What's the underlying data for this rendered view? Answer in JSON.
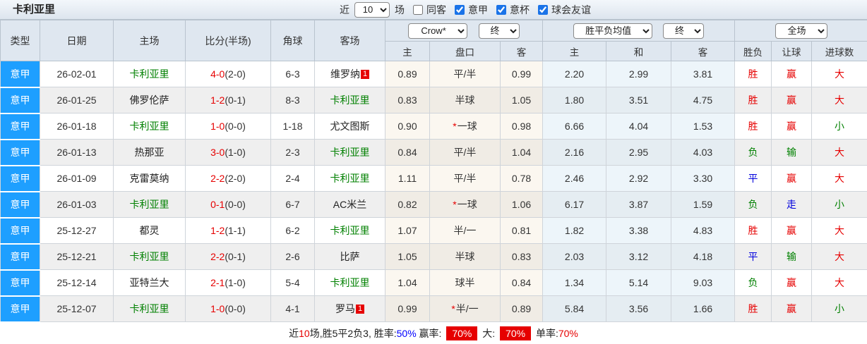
{
  "topbar": {
    "title": "卡利亚里",
    "near_label": "近",
    "near_value": "10",
    "games_label": "场",
    "filters": [
      {
        "label": "同客",
        "checked": false
      },
      {
        "label": "意甲",
        "checked": true
      },
      {
        "label": "意杯",
        "checked": true
      },
      {
        "label": "球会友谊",
        "checked": true
      }
    ]
  },
  "colors": {
    "league_cell_blue": "#1e9fff",
    "self_team_green": "#008000",
    "win_red": "#e60000",
    "draw_blue": "#0000dd",
    "rate_blue": "#0000ff"
  },
  "table": {
    "left_headers": [
      "类型",
      "日期",
      "主场",
      "比分(半场)",
      "角球",
      "客场"
    ],
    "odds_group": {
      "provider_select": "Crow*",
      "time_select": "终",
      "subcols": [
        "主",
        "盘口",
        "客"
      ]
    },
    "avg_group": {
      "name_select": "胜平负均值",
      "time_select": "终",
      "subcols": [
        "主",
        "和",
        "客"
      ]
    },
    "result_group": {
      "scope_select": "全场",
      "subcols": [
        "胜负",
        "让球",
        "进球数"
      ]
    },
    "rows": [
      {
        "league": "意甲",
        "date": "26-02-01",
        "home": "卡利亚里",
        "home_is_self": true,
        "home_badge": null,
        "score_ft": "4-0",
        "score_ht": "(2-0)",
        "corners": "6-3",
        "away": "维罗纳",
        "away_is_self": false,
        "away_badge": "1",
        "odds_home": "0.89",
        "handicap_star": false,
        "handicap": "平/半",
        "odds_away": "0.99",
        "avg_home": "2.20",
        "avg_draw": "2.99",
        "avg_away": "3.81",
        "result": {
          "t": "胜",
          "c": "red"
        },
        "handicap_result": {
          "t": "赢",
          "c": "red"
        },
        "goals": {
          "t": "大",
          "c": "red"
        }
      },
      {
        "league": "意甲",
        "date": "26-01-25",
        "home": "佛罗伦萨",
        "home_is_self": false,
        "home_badge": null,
        "score_ft": "1-2",
        "score_ht": "(0-1)",
        "corners": "8-3",
        "away": "卡利亚里",
        "away_is_self": true,
        "away_badge": null,
        "odds_home": "0.83",
        "handicap_star": false,
        "handicap": "半球",
        "odds_away": "1.05",
        "avg_home": "1.80",
        "avg_draw": "3.51",
        "avg_away": "4.75",
        "result": {
          "t": "胜",
          "c": "red"
        },
        "handicap_result": {
          "t": "赢",
          "c": "red"
        },
        "goals": {
          "t": "大",
          "c": "red"
        }
      },
      {
        "league": "意甲",
        "date": "26-01-18",
        "home": "卡利亚里",
        "home_is_self": true,
        "home_badge": null,
        "score_ft": "1-0",
        "score_ht": "(0-0)",
        "corners": "1-18",
        "away": "尤文图斯",
        "away_is_self": false,
        "away_badge": null,
        "odds_home": "0.90",
        "handicap_star": true,
        "handicap": "一球",
        "odds_away": "0.98",
        "avg_home": "6.66",
        "avg_draw": "4.04",
        "avg_away": "1.53",
        "result": {
          "t": "胜",
          "c": "red"
        },
        "handicap_result": {
          "t": "赢",
          "c": "red"
        },
        "goals": {
          "t": "小",
          "c": "green"
        }
      },
      {
        "league": "意甲",
        "date": "26-01-13",
        "home": "热那亚",
        "home_is_self": false,
        "home_badge": null,
        "score_ft": "3-0",
        "score_ht": "(1-0)",
        "corners": "2-3",
        "away": "卡利亚里",
        "away_is_self": true,
        "away_badge": null,
        "odds_home": "0.84",
        "handicap_star": false,
        "handicap": "平/半",
        "odds_away": "1.04",
        "avg_home": "2.16",
        "avg_draw": "2.95",
        "avg_away": "4.03",
        "result": {
          "t": "负",
          "c": "green"
        },
        "handicap_result": {
          "t": "输",
          "c": "green"
        },
        "goals": {
          "t": "大",
          "c": "red"
        }
      },
      {
        "league": "意甲",
        "date": "26-01-09",
        "home": "克雷莫纳",
        "home_is_self": false,
        "home_badge": null,
        "score_ft": "2-2",
        "score_ht": "(2-0)",
        "corners": "2-4",
        "away": "卡利亚里",
        "away_is_self": true,
        "away_badge": null,
        "odds_home": "1.11",
        "handicap_star": false,
        "handicap": "平/半",
        "odds_away": "0.78",
        "avg_home": "2.46",
        "avg_draw": "2.92",
        "avg_away": "3.30",
        "result": {
          "t": "平",
          "c": "blue"
        },
        "handicap_result": {
          "t": "赢",
          "c": "red"
        },
        "goals": {
          "t": "大",
          "c": "red"
        }
      },
      {
        "league": "意甲",
        "date": "26-01-03",
        "home": "卡利亚里",
        "home_is_self": true,
        "home_badge": null,
        "score_ft": "0-1",
        "score_ht": "(0-0)",
        "corners": "6-7",
        "away": "AC米兰",
        "away_is_self": false,
        "away_badge": null,
        "odds_home": "0.82",
        "handicap_star": true,
        "handicap": "一球",
        "odds_away": "1.06",
        "avg_home": "6.17",
        "avg_draw": "3.87",
        "avg_away": "1.59",
        "result": {
          "t": "负",
          "c": "green"
        },
        "handicap_result": {
          "t": "走",
          "c": "blue"
        },
        "goals": {
          "t": "小",
          "c": "green"
        }
      },
      {
        "league": "意甲",
        "date": "25-12-27",
        "home": "都灵",
        "home_is_self": false,
        "home_badge": null,
        "score_ft": "1-2",
        "score_ht": "(1-1)",
        "corners": "6-2",
        "away": "卡利亚里",
        "away_is_self": true,
        "away_badge": null,
        "odds_home": "1.07",
        "handicap_star": false,
        "handicap": "半/一",
        "odds_away": "0.81",
        "avg_home": "1.82",
        "avg_draw": "3.38",
        "avg_away": "4.83",
        "result": {
          "t": "胜",
          "c": "red"
        },
        "handicap_result": {
          "t": "赢",
          "c": "red"
        },
        "goals": {
          "t": "大",
          "c": "red"
        }
      },
      {
        "league": "意甲",
        "date": "25-12-21",
        "home": "卡利亚里",
        "home_is_self": true,
        "home_badge": null,
        "score_ft": "2-2",
        "score_ht": "(0-1)",
        "corners": "2-6",
        "away": "比萨",
        "away_is_self": false,
        "away_badge": null,
        "odds_home": "1.05",
        "handicap_star": false,
        "handicap": "半球",
        "odds_away": "0.83",
        "avg_home": "2.03",
        "avg_draw": "3.12",
        "avg_away": "4.18",
        "result": {
          "t": "平",
          "c": "blue"
        },
        "handicap_result": {
          "t": "输",
          "c": "green"
        },
        "goals": {
          "t": "大",
          "c": "red"
        }
      },
      {
        "league": "意甲",
        "date": "25-12-14",
        "home": "亚特兰大",
        "home_is_self": false,
        "home_badge": null,
        "score_ft": "2-1",
        "score_ht": "(1-0)",
        "corners": "5-4",
        "away": "卡利亚里",
        "away_is_self": true,
        "away_badge": null,
        "odds_home": "1.04",
        "handicap_star": false,
        "handicap": "球半",
        "odds_away": "0.84",
        "avg_home": "1.34",
        "avg_draw": "5.14",
        "avg_away": "9.03",
        "result": {
          "t": "负",
          "c": "green"
        },
        "handicap_result": {
          "t": "赢",
          "c": "red"
        },
        "goals": {
          "t": "大",
          "c": "red"
        }
      },
      {
        "league": "意甲",
        "date": "25-12-07",
        "home": "卡利亚里",
        "home_is_self": true,
        "home_badge": null,
        "score_ft": "1-0",
        "score_ht": "(0-0)",
        "corners": "4-1",
        "away": "罗马",
        "away_is_self": false,
        "away_badge": "1",
        "odds_home": "0.99",
        "handicap_star": true,
        "handicap": "半/一",
        "odds_away": "0.89",
        "avg_home": "5.84",
        "avg_draw": "3.56",
        "avg_away": "1.66",
        "result": {
          "t": "胜",
          "c": "red"
        },
        "handicap_result": {
          "t": "赢",
          "c": "red"
        },
        "goals": {
          "t": "小",
          "c": "green"
        }
      }
    ]
  },
  "footer": {
    "segments": [
      {
        "text": "近",
        "style": "dark"
      },
      {
        "text": "10",
        "style": "red"
      },
      {
        "text": "场,胜5平2负3, 胜率:",
        "style": "dark"
      },
      {
        "text": "50%",
        "style": "blue"
      },
      {
        "text": " 赢率: ",
        "style": "dark"
      },
      {
        "text": "70%",
        "style": "red-badge"
      },
      {
        "text": " 大: ",
        "style": "dark"
      },
      {
        "text": "70%",
        "style": "red-badge"
      },
      {
        "text": " 单率:",
        "style": "dark"
      },
      {
        "text": "70%",
        "style": "red"
      }
    ]
  }
}
